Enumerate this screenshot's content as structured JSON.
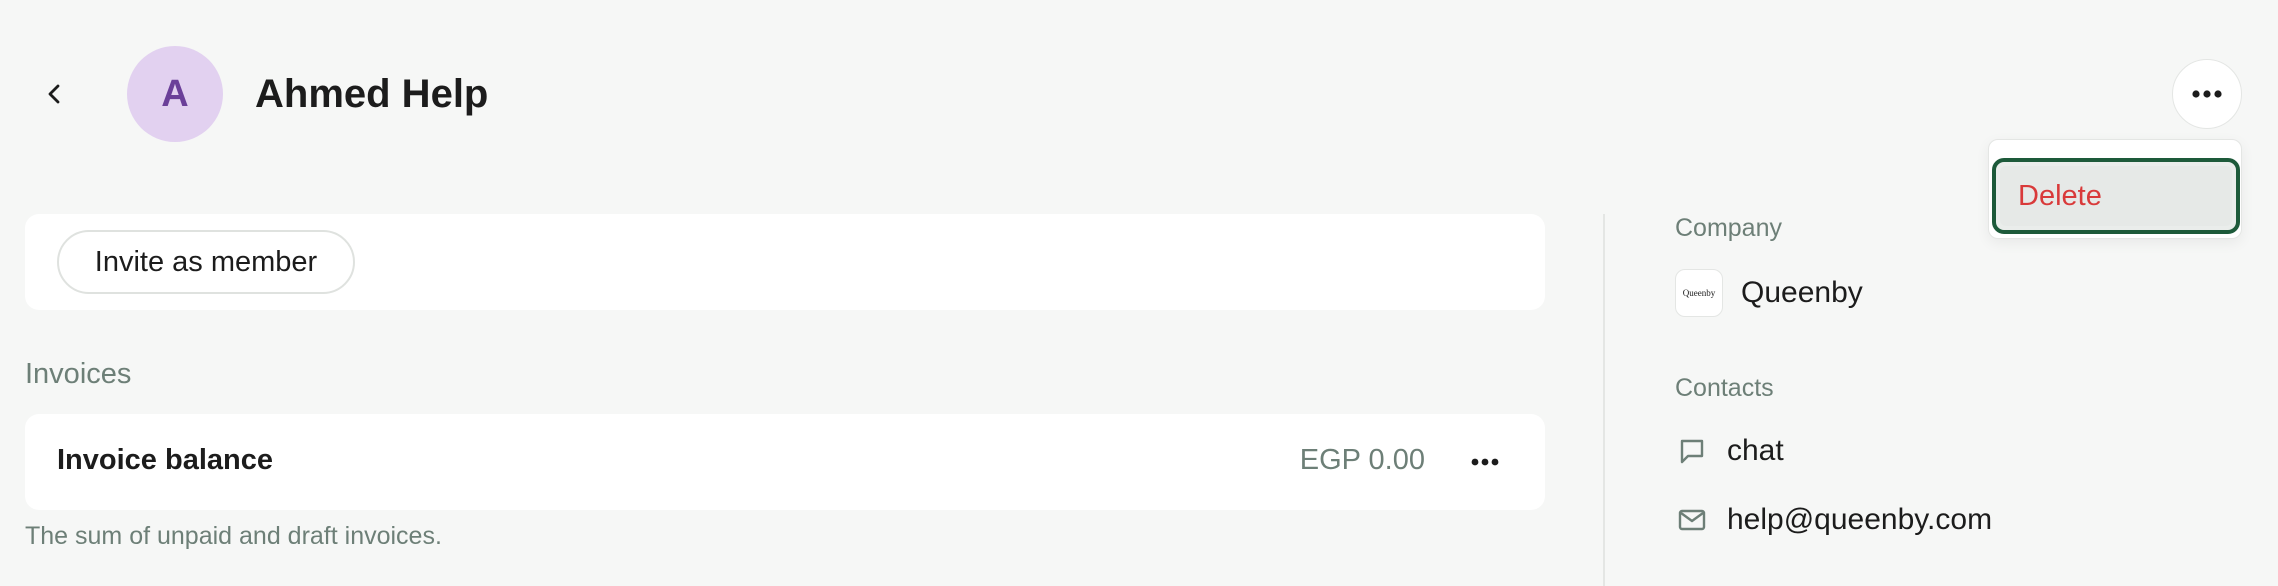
{
  "header": {
    "avatar_initial": "A",
    "title": "Ahmed Help"
  },
  "menu": {
    "delete_label": "Delete"
  },
  "invite": {
    "button_label": "Invite as member"
  },
  "invoices": {
    "section_label": "Invoices",
    "card_title": "Invoice balance",
    "amount": "EGP 0.00",
    "note": "The sum of unpaid and draft invoices."
  },
  "company": {
    "label": "Company",
    "logo_text": "Queenby",
    "name": "Queenby"
  },
  "contacts": {
    "label": "Contacts",
    "items": [
      {
        "icon": "chat-icon",
        "text": "chat"
      },
      {
        "icon": "mail-icon",
        "text": "help@queenby.com"
      }
    ]
  },
  "colors": {
    "avatar_bg": "#e2d1f0",
    "avatar_text": "#6b3f99",
    "delete_text": "#d93a3a",
    "focus_ring": "#1d5a3a",
    "muted_text": "#6d7f77"
  }
}
